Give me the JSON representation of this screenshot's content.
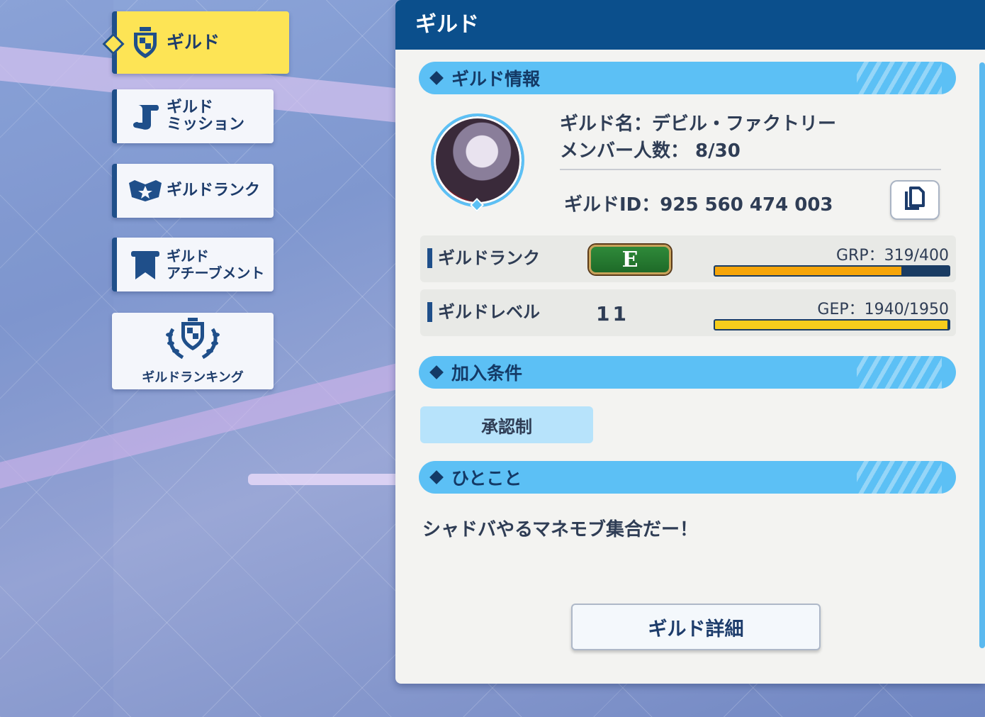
{
  "nav": {
    "guild": "ギルド",
    "mission": "ギルド\nミッション",
    "rank": "ギルドランク",
    "achievement": "ギルド\nアチーブメント",
    "ranking": "ギルドランキング"
  },
  "panel": {
    "title": "ギルド"
  },
  "guild_info": {
    "section_title": "ギルド情報",
    "name_line": "ギルド名：デビル・ファクトリー",
    "members_line": "メンバー人数： 8/30",
    "id_line": "ギルドID：925 560 474 003"
  },
  "rank_row": {
    "label": "ギルドランク",
    "rank": "E",
    "caption": "GRP：319/400",
    "fill_ratio": 0.7975,
    "fill_color": "#f5a50a"
  },
  "level_row": {
    "label": "ギルドレベル",
    "level": "11",
    "caption": "GEP：1940/1950",
    "fill_ratio": 0.9949,
    "fill_color": "#f6cd1c"
  },
  "join": {
    "section_title": "加入条件",
    "condition": "承認制"
  },
  "comment": {
    "section_title": "ひとこと",
    "text": "シャドバやるマネモブ集合だー！"
  },
  "detail_button": "ギルド詳細",
  "icons": [
    "shield-icon",
    "scroll-icon",
    "rank-emblem-icon",
    "banner-icon",
    "laurel-shield-icon",
    "copy-icon",
    "avatar"
  ]
}
